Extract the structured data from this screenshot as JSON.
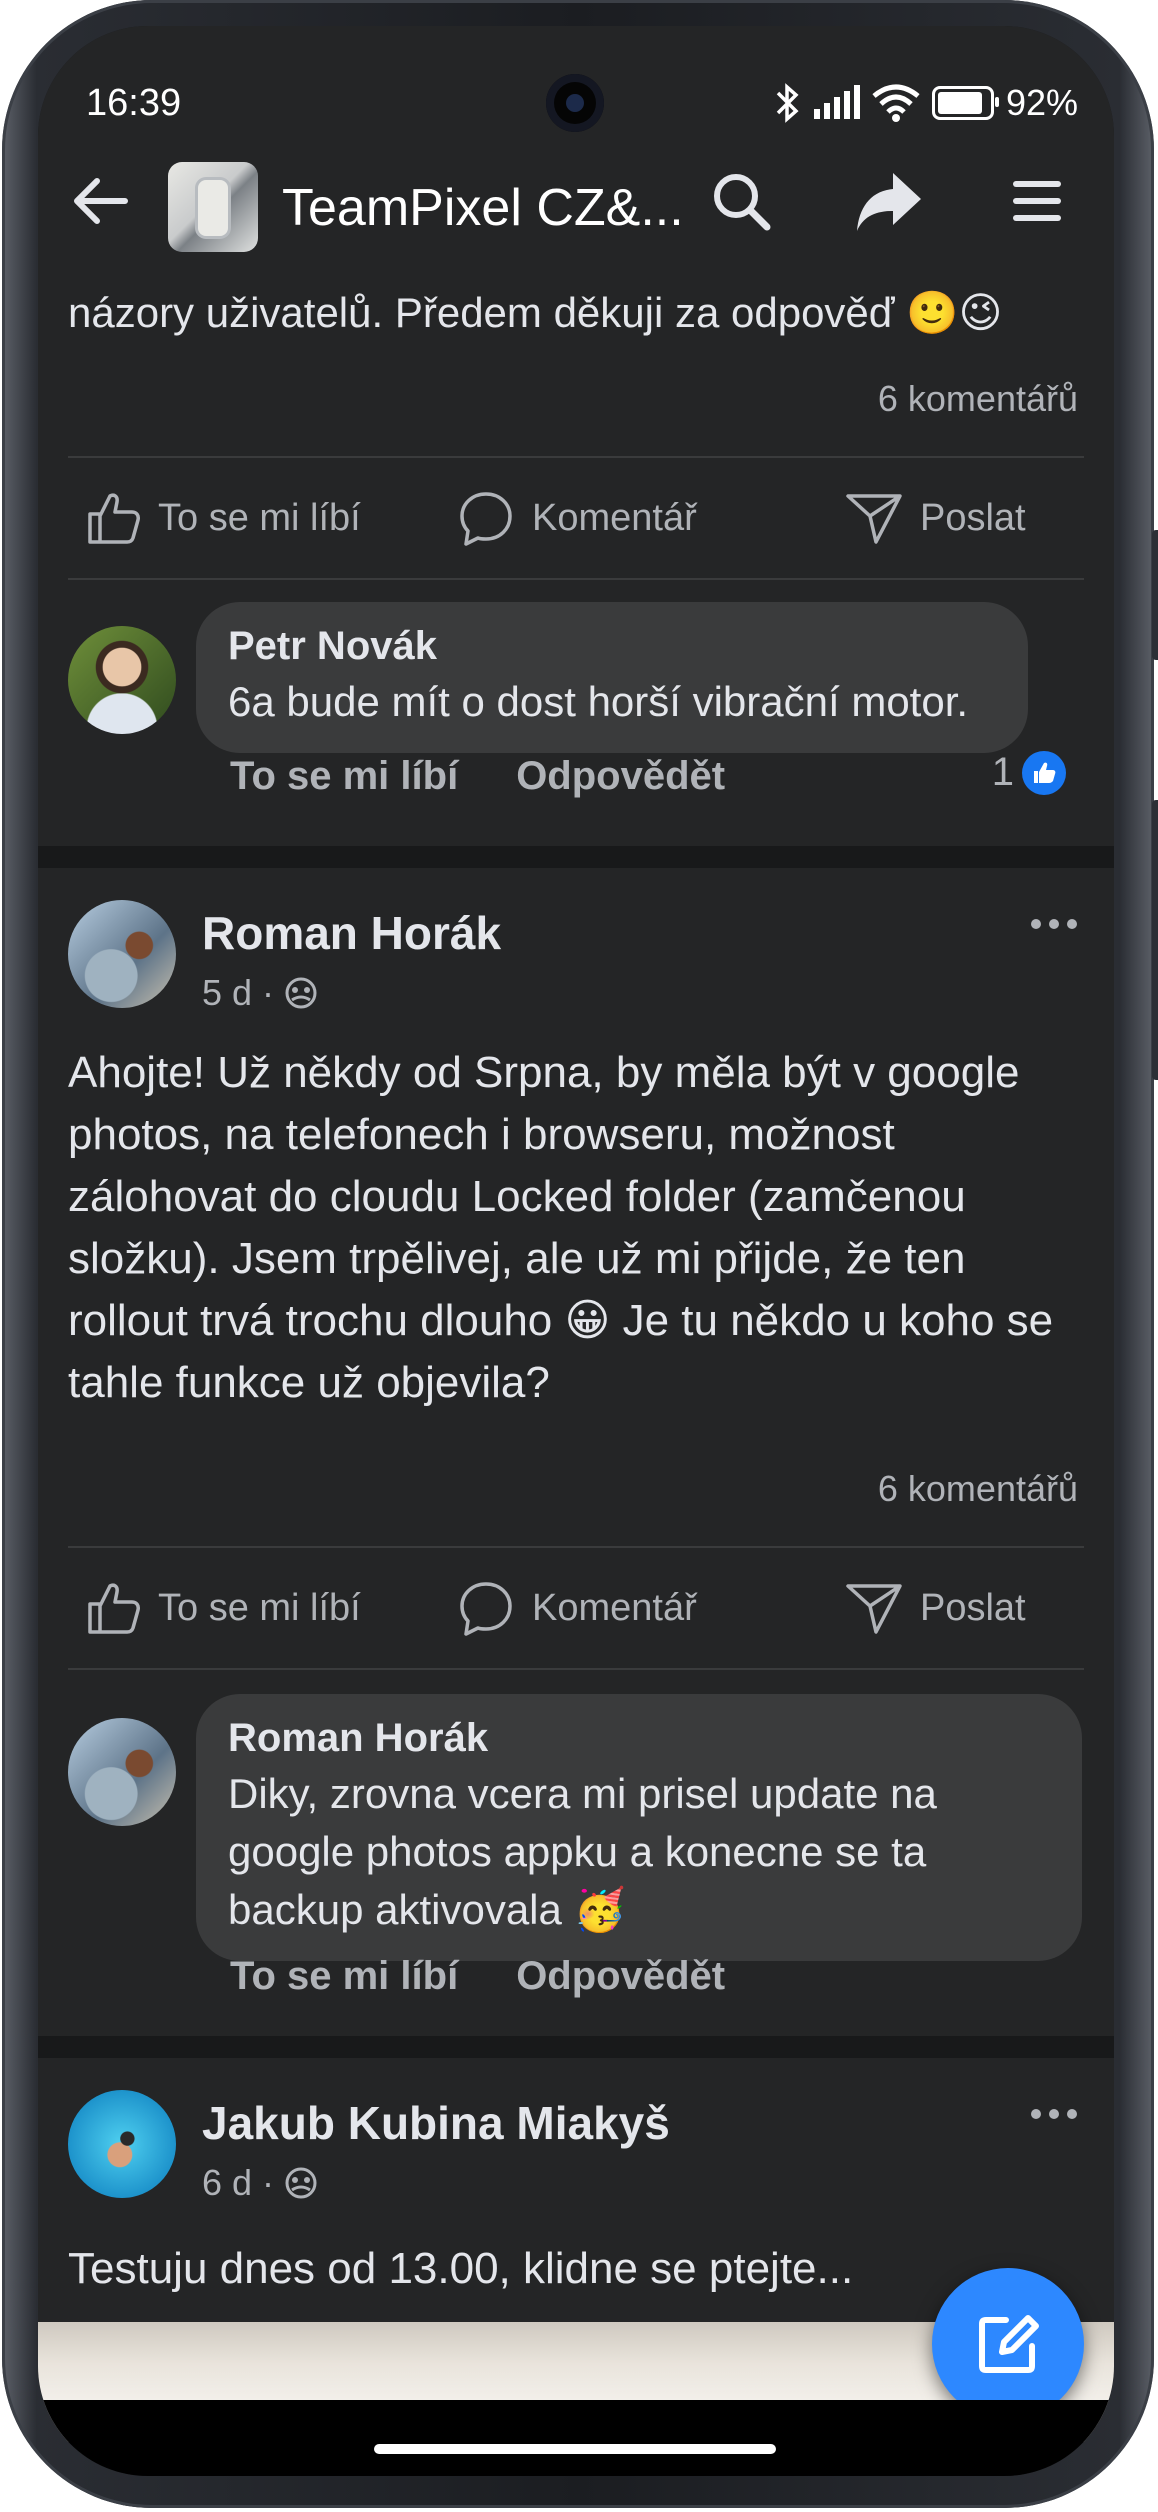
{
  "status_bar": {
    "time": "16:39",
    "battery": "92%",
    "battery_level": 0.92
  },
  "app_bar": {
    "title": "TeamPixel CZ&...",
    "icons": [
      "back-arrow-icon",
      "search-icon",
      "share-icon",
      "menu-icon"
    ]
  },
  "feed": {
    "post1": {
      "text_fragment": "názory uživatelů. Předem děkuji za odpověď 🙂😉",
      "comments_count": "6 komentářů",
      "actions": {
        "like": "To se mi líbí",
        "comment": "Komentář",
        "send": "Poslat"
      },
      "top_comment": {
        "author": "Petr Novák",
        "text": "6a bude mít o dost horší vibrační motor.",
        "like_label": "To se mi líbí",
        "reply_label": "Odpovědět",
        "reactions": "1"
      }
    },
    "post2": {
      "author": "Roman Horák",
      "time": "5 d",
      "privacy_dot": "·",
      "body": "Ahojte! Už někdy od Srpna, by měla být v google photos, na telefonech i browseru, možnost zálohovat do cloudu Locked folder (zamčenou složku). Jsem trpělivej, ale už mi přijde, že ten rollout trvá trochu dlouho 😀 Je tu někdo u koho se tahle funkce už objevila?",
      "comments_count": "6 komentářů",
      "actions": {
        "like": "To se mi líbí",
        "comment": "Komentář",
        "send": "Poslat"
      },
      "top_comment": {
        "author": "Roman Horák",
        "text": "Diky, zrovna vcera mi prisel update na google photos appku a konecne se ta backup aktivovala 🥳",
        "like_label": "To se mi líbí",
        "reply_label": "Odpovědět"
      }
    },
    "post3": {
      "author": "Jakub Kubina Miakyš",
      "time": "6 d",
      "privacy_dot": "·",
      "body": "Testuju dnes od 13.00, klidne se ptejte..."
    }
  },
  "colors": {
    "background": "#18191a",
    "card": "#242526",
    "bubble": "#3a3b3c",
    "accent": "#2d88ff"
  }
}
